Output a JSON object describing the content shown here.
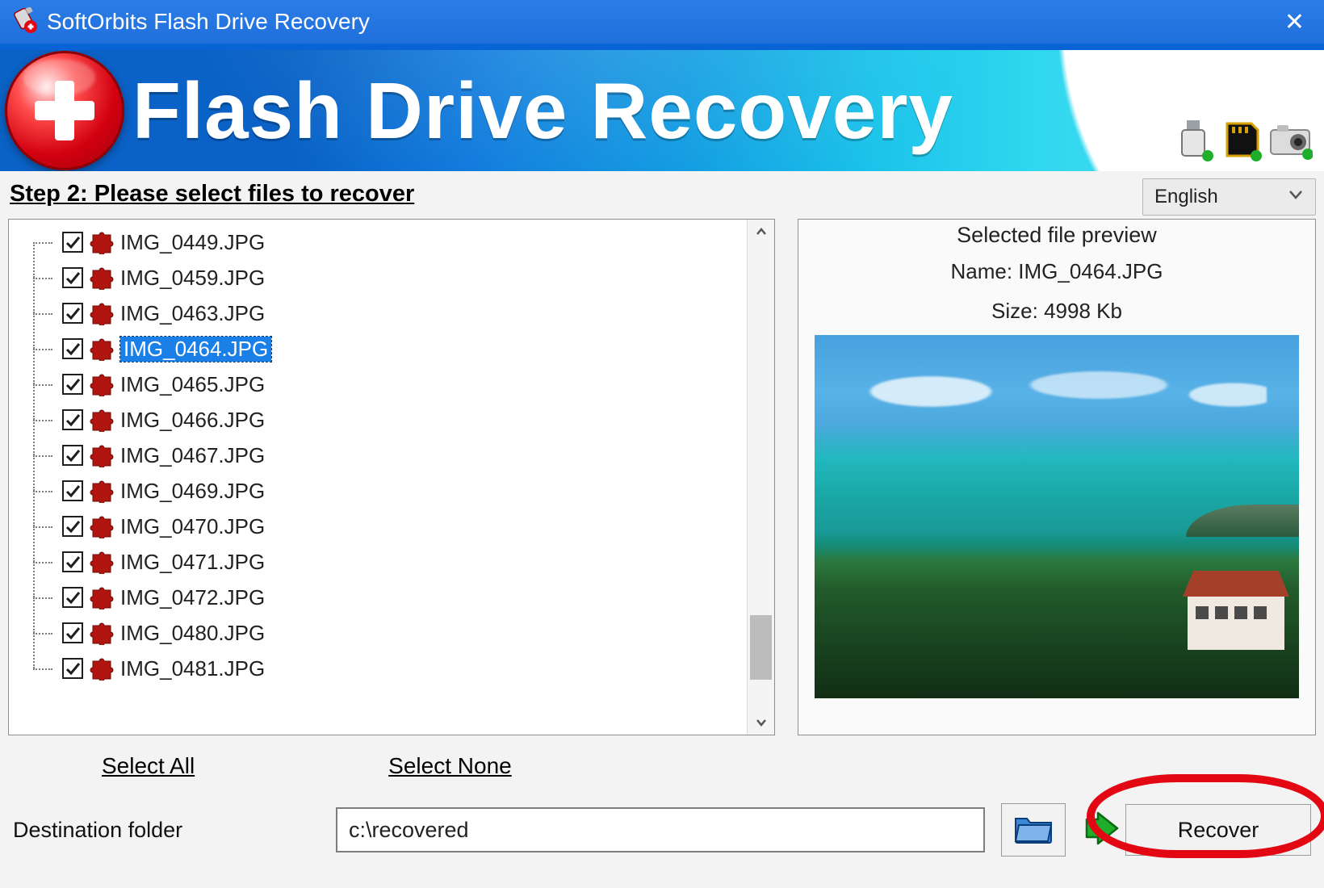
{
  "window": {
    "title": "SoftOrbits Flash Drive Recovery"
  },
  "header": {
    "app_title": "Flash Drive Recovery"
  },
  "language": {
    "selected": "English"
  },
  "step": {
    "label": "Step 2: Please select files to recover"
  },
  "files": [
    {
      "name": "IMG_0449.JPG",
      "checked": true,
      "selected": false
    },
    {
      "name": "IMG_0459.JPG",
      "checked": true,
      "selected": false
    },
    {
      "name": "IMG_0463.JPG",
      "checked": true,
      "selected": false
    },
    {
      "name": "IMG_0464.JPG",
      "checked": true,
      "selected": true
    },
    {
      "name": "IMG_0465.JPG",
      "checked": true,
      "selected": false
    },
    {
      "name": "IMG_0466.JPG",
      "checked": true,
      "selected": false
    },
    {
      "name": "IMG_0467.JPG",
      "checked": true,
      "selected": false
    },
    {
      "name": "IMG_0469.JPG",
      "checked": true,
      "selected": false
    },
    {
      "name": "IMG_0470.JPG",
      "checked": true,
      "selected": false
    },
    {
      "name": "IMG_0471.JPG",
      "checked": true,
      "selected": false
    },
    {
      "name": "IMG_0472.JPG",
      "checked": true,
      "selected": false
    },
    {
      "name": "IMG_0480.JPG",
      "checked": true,
      "selected": false
    },
    {
      "name": "IMG_0481.JPG",
      "checked": true,
      "selected": false
    }
  ],
  "preview": {
    "header": "Selected file preview",
    "name_label": "Name: IMG_0464.JPG",
    "size_label": "Size: 4998 Kb"
  },
  "actions": {
    "select_all": "Select All",
    "select_none": "Select None"
  },
  "destination": {
    "label": "Destination folder",
    "value": "c:\\recovered"
  },
  "buttons": {
    "recover": "Recover"
  },
  "colors": {
    "titlebar": "#2176e3",
    "accent_red": "#d20010",
    "selection": "#1a7fe6",
    "highlight": "#e30613"
  }
}
